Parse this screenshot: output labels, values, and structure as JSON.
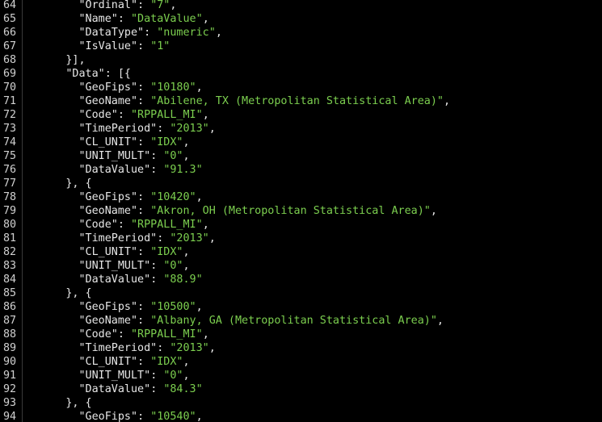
{
  "editor": {
    "colors": {
      "background": "#000000",
      "line_number": "#d0d0d0",
      "key": "#e6e6e6",
      "string": "#7ccf4f",
      "divider": "#3a3a3a"
    },
    "lines": [
      {
        "number": "64",
        "tokens": [
          {
            "text": "        ",
            "type": "p"
          },
          {
            "text": "\"Ordinal\"",
            "type": "k"
          },
          {
            "text": ": ",
            "type": "p"
          },
          {
            "text": "\"7\"",
            "type": "s"
          },
          {
            "text": ",",
            "type": "p"
          }
        ]
      },
      {
        "number": "65",
        "tokens": [
          {
            "text": "        ",
            "type": "p"
          },
          {
            "text": "\"Name\"",
            "type": "k"
          },
          {
            "text": ": ",
            "type": "p"
          },
          {
            "text": "\"DataValue\"",
            "type": "s"
          },
          {
            "text": ",",
            "type": "p"
          }
        ]
      },
      {
        "number": "66",
        "tokens": [
          {
            "text": "        ",
            "type": "p"
          },
          {
            "text": "\"DataType\"",
            "type": "k"
          },
          {
            "text": ": ",
            "type": "p"
          },
          {
            "text": "\"numeric\"",
            "type": "s"
          },
          {
            "text": ",",
            "type": "p"
          }
        ]
      },
      {
        "number": "67",
        "tokens": [
          {
            "text": "        ",
            "type": "p"
          },
          {
            "text": "\"IsValue\"",
            "type": "k"
          },
          {
            "text": ": ",
            "type": "p"
          },
          {
            "text": "\"1\"",
            "type": "s"
          }
        ]
      },
      {
        "number": "68",
        "tokens": [
          {
            "text": "      }],",
            "type": "p"
          }
        ]
      },
      {
        "number": "69",
        "tokens": [
          {
            "text": "      ",
            "type": "p"
          },
          {
            "text": "\"Data\"",
            "type": "k"
          },
          {
            "text": ": [{",
            "type": "p"
          }
        ]
      },
      {
        "number": "70",
        "tokens": [
          {
            "text": "        ",
            "type": "p"
          },
          {
            "text": "\"GeoFips\"",
            "type": "k"
          },
          {
            "text": ": ",
            "type": "p"
          },
          {
            "text": "\"10180\"",
            "type": "s"
          },
          {
            "text": ",",
            "type": "p"
          }
        ]
      },
      {
        "number": "71",
        "tokens": [
          {
            "text": "        ",
            "type": "p"
          },
          {
            "text": "\"GeoName\"",
            "type": "k"
          },
          {
            "text": ": ",
            "type": "p"
          },
          {
            "text": "\"Abilene, TX (Metropolitan Statistical Area)\"",
            "type": "s"
          },
          {
            "text": ",",
            "type": "p"
          }
        ]
      },
      {
        "number": "72",
        "tokens": [
          {
            "text": "        ",
            "type": "p"
          },
          {
            "text": "\"Code\"",
            "type": "k"
          },
          {
            "text": ": ",
            "type": "p"
          },
          {
            "text": "\"RPPALL_MI\"",
            "type": "s"
          },
          {
            "text": ",",
            "type": "p"
          }
        ]
      },
      {
        "number": "73",
        "tokens": [
          {
            "text": "        ",
            "type": "p"
          },
          {
            "text": "\"TimePeriod\"",
            "type": "k"
          },
          {
            "text": ": ",
            "type": "p"
          },
          {
            "text": "\"2013\"",
            "type": "s"
          },
          {
            "text": ",",
            "type": "p"
          }
        ]
      },
      {
        "number": "74",
        "tokens": [
          {
            "text": "        ",
            "type": "p"
          },
          {
            "text": "\"CL_UNIT\"",
            "type": "k"
          },
          {
            "text": ": ",
            "type": "p"
          },
          {
            "text": "\"IDX\"",
            "type": "s"
          },
          {
            "text": ",",
            "type": "p"
          }
        ]
      },
      {
        "number": "75",
        "tokens": [
          {
            "text": "        ",
            "type": "p"
          },
          {
            "text": "\"UNIT_MULT\"",
            "type": "k"
          },
          {
            "text": ": ",
            "type": "p"
          },
          {
            "text": "\"0\"",
            "type": "s"
          },
          {
            "text": ",",
            "type": "p"
          }
        ]
      },
      {
        "number": "76",
        "tokens": [
          {
            "text": "        ",
            "type": "p"
          },
          {
            "text": "\"DataValue\"",
            "type": "k"
          },
          {
            "text": ": ",
            "type": "p"
          },
          {
            "text": "\"91.3\"",
            "type": "s"
          }
        ]
      },
      {
        "number": "77",
        "tokens": [
          {
            "text": "      }, {",
            "type": "p"
          }
        ]
      },
      {
        "number": "78",
        "tokens": [
          {
            "text": "        ",
            "type": "p"
          },
          {
            "text": "\"GeoFips\"",
            "type": "k"
          },
          {
            "text": ": ",
            "type": "p"
          },
          {
            "text": "\"10420\"",
            "type": "s"
          },
          {
            "text": ",",
            "type": "p"
          }
        ]
      },
      {
        "number": "79",
        "tokens": [
          {
            "text": "        ",
            "type": "p"
          },
          {
            "text": "\"GeoName\"",
            "type": "k"
          },
          {
            "text": ": ",
            "type": "p"
          },
          {
            "text": "\"Akron, OH (Metropolitan Statistical Area)\"",
            "type": "s"
          },
          {
            "text": ",",
            "type": "p"
          }
        ]
      },
      {
        "number": "80",
        "tokens": [
          {
            "text": "        ",
            "type": "p"
          },
          {
            "text": "\"Code\"",
            "type": "k"
          },
          {
            "text": ": ",
            "type": "p"
          },
          {
            "text": "\"RPPALL_MI\"",
            "type": "s"
          },
          {
            "text": ",",
            "type": "p"
          }
        ]
      },
      {
        "number": "81",
        "tokens": [
          {
            "text": "        ",
            "type": "p"
          },
          {
            "text": "\"TimePeriod\"",
            "type": "k"
          },
          {
            "text": ": ",
            "type": "p"
          },
          {
            "text": "\"2013\"",
            "type": "s"
          },
          {
            "text": ",",
            "type": "p"
          }
        ]
      },
      {
        "number": "82",
        "tokens": [
          {
            "text": "        ",
            "type": "p"
          },
          {
            "text": "\"CL_UNIT\"",
            "type": "k"
          },
          {
            "text": ": ",
            "type": "p"
          },
          {
            "text": "\"IDX\"",
            "type": "s"
          },
          {
            "text": ",",
            "type": "p"
          }
        ]
      },
      {
        "number": "83",
        "tokens": [
          {
            "text": "        ",
            "type": "p"
          },
          {
            "text": "\"UNIT_MULT\"",
            "type": "k"
          },
          {
            "text": ": ",
            "type": "p"
          },
          {
            "text": "\"0\"",
            "type": "s"
          },
          {
            "text": ",",
            "type": "p"
          }
        ]
      },
      {
        "number": "84",
        "tokens": [
          {
            "text": "        ",
            "type": "p"
          },
          {
            "text": "\"DataValue\"",
            "type": "k"
          },
          {
            "text": ": ",
            "type": "p"
          },
          {
            "text": "\"88.9\"",
            "type": "s"
          }
        ]
      },
      {
        "number": "85",
        "tokens": [
          {
            "text": "      }, {",
            "type": "p"
          }
        ]
      },
      {
        "number": "86",
        "tokens": [
          {
            "text": "        ",
            "type": "p"
          },
          {
            "text": "\"GeoFips\"",
            "type": "k"
          },
          {
            "text": ": ",
            "type": "p"
          },
          {
            "text": "\"10500\"",
            "type": "s"
          },
          {
            "text": ",",
            "type": "p"
          }
        ]
      },
      {
        "number": "87",
        "tokens": [
          {
            "text": "        ",
            "type": "p"
          },
          {
            "text": "\"GeoName\"",
            "type": "k"
          },
          {
            "text": ": ",
            "type": "p"
          },
          {
            "text": "\"Albany, GA (Metropolitan Statistical Area)\"",
            "type": "s"
          },
          {
            "text": ",",
            "type": "p"
          }
        ]
      },
      {
        "number": "88",
        "tokens": [
          {
            "text": "        ",
            "type": "p"
          },
          {
            "text": "\"Code\"",
            "type": "k"
          },
          {
            "text": ": ",
            "type": "p"
          },
          {
            "text": "\"RPPALL_MI\"",
            "type": "s"
          },
          {
            "text": ",",
            "type": "p"
          }
        ]
      },
      {
        "number": "89",
        "tokens": [
          {
            "text": "        ",
            "type": "p"
          },
          {
            "text": "\"TimePeriod\"",
            "type": "k"
          },
          {
            "text": ": ",
            "type": "p"
          },
          {
            "text": "\"2013\"",
            "type": "s"
          },
          {
            "text": ",",
            "type": "p"
          }
        ]
      },
      {
        "number": "90",
        "tokens": [
          {
            "text": "        ",
            "type": "p"
          },
          {
            "text": "\"CL_UNIT\"",
            "type": "k"
          },
          {
            "text": ": ",
            "type": "p"
          },
          {
            "text": "\"IDX\"",
            "type": "s"
          },
          {
            "text": ",",
            "type": "p"
          }
        ]
      },
      {
        "number": "91",
        "tokens": [
          {
            "text": "        ",
            "type": "p"
          },
          {
            "text": "\"UNIT_MULT\"",
            "type": "k"
          },
          {
            "text": ": ",
            "type": "p"
          },
          {
            "text": "\"0\"",
            "type": "s"
          },
          {
            "text": ",",
            "type": "p"
          }
        ]
      },
      {
        "number": "92",
        "tokens": [
          {
            "text": "        ",
            "type": "p"
          },
          {
            "text": "\"DataValue\"",
            "type": "k"
          },
          {
            "text": ": ",
            "type": "p"
          },
          {
            "text": "\"84.3\"",
            "type": "s"
          }
        ]
      },
      {
        "number": "93",
        "tokens": [
          {
            "text": "      }, {",
            "type": "p"
          }
        ]
      },
      {
        "number": "94",
        "tokens": [
          {
            "text": "        ",
            "type": "p"
          },
          {
            "text": "\"GeoFips\"",
            "type": "k"
          },
          {
            "text": ": ",
            "type": "p"
          },
          {
            "text": "\"10540\"",
            "type": "s"
          },
          {
            "text": ",",
            "type": "p"
          }
        ]
      }
    ]
  }
}
